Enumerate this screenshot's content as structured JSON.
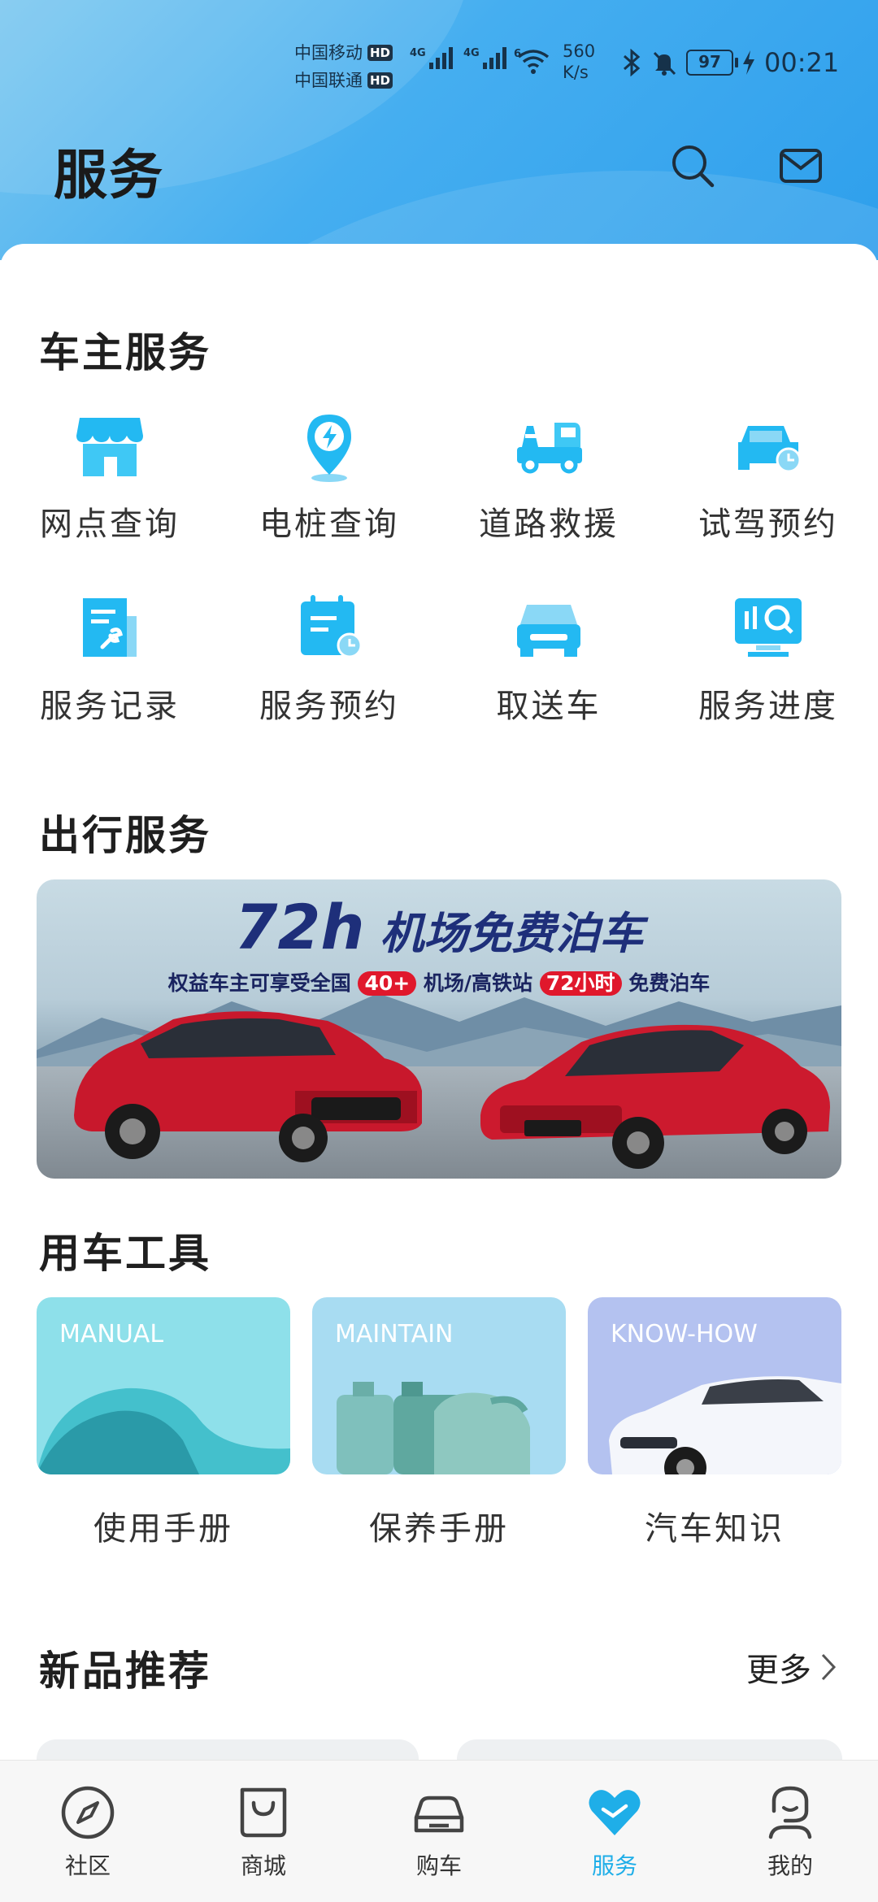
{
  "status_bar": {
    "carrier1": "中国移动",
    "carrier2": "中国联通",
    "hd": "HD",
    "net1": "4G",
    "net2": "4G",
    "wifi_tag": "6",
    "speed_value": "560",
    "speed_unit": "K/s",
    "battery": "97",
    "time": "00:21"
  },
  "header": {
    "title": "服务",
    "search_icon": "search-icon",
    "message_icon": "mail-icon"
  },
  "owner_services": {
    "title": "车主服务",
    "items": [
      {
        "label": "网点查询",
        "icon": "store-icon"
      },
      {
        "label": "电桩查询",
        "icon": "charging-pin-icon"
      },
      {
        "label": "道路救援",
        "icon": "tow-truck-icon"
      },
      {
        "label": "试驾预约",
        "icon": "car-clock-icon"
      },
      {
        "label": "服务记录",
        "icon": "document-wrench-icon"
      },
      {
        "label": "服务预约",
        "icon": "calendar-clock-icon"
      },
      {
        "label": "取送车",
        "icon": "car-front-icon"
      },
      {
        "label": "服务进度",
        "icon": "monitor-search-icon"
      }
    ]
  },
  "travel_services": {
    "title": "出行服务",
    "banner": {
      "headline_big": "72h",
      "headline": "机场免费泊车",
      "sub_prefix": "权益车主可享受全国",
      "sub_pill1": "40+",
      "sub_mid": "机场/高铁站",
      "sub_pill2": "72小时",
      "sub_suffix": "免费泊车"
    }
  },
  "car_tools": {
    "title": "用车工具",
    "items": [
      {
        "tag": "MANUAL",
        "label": "使用手册",
        "color": "#8ee0ea"
      },
      {
        "tag": "MAINTAIN",
        "label": "保养手册",
        "color": "#a8dcf2"
      },
      {
        "tag": "KNOW-HOW",
        "label": "汽车知识",
        "color": "#b4c2f0"
      }
    ]
  },
  "new_products": {
    "title": "新品推荐",
    "more": "更多"
  },
  "bottom_nav": {
    "items": [
      {
        "label": "社区",
        "icon": "compass-icon"
      },
      {
        "label": "商城",
        "icon": "shopping-bag-icon"
      },
      {
        "label": "购车",
        "icon": "car-icon"
      },
      {
        "label": "服务",
        "icon": "heart-icon",
        "active": true
      },
      {
        "label": "我的",
        "icon": "profile-icon"
      }
    ],
    "accent": "#1faee8"
  }
}
